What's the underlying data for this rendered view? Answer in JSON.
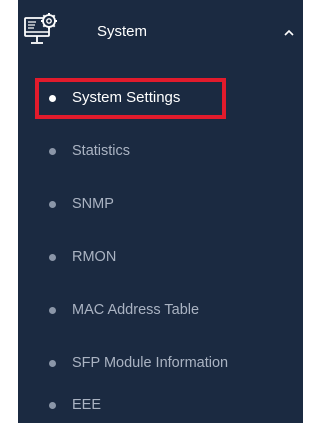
{
  "sidebar": {
    "section": {
      "title": "System",
      "icon": "system-settings-icon",
      "expanded": true,
      "chevron": "chevron-up-icon"
    },
    "items": [
      {
        "label": "System Settings",
        "active": true
      },
      {
        "label": "Statistics",
        "active": false
      },
      {
        "label": "SNMP",
        "active": false
      },
      {
        "label": "RMON",
        "active": false
      },
      {
        "label": "MAC Address Table",
        "active": false
      },
      {
        "label": "SFP Module Information",
        "active": false
      },
      {
        "label": "EEE",
        "active": false
      }
    ]
  },
  "colors": {
    "sidebar_bg": "#1b2a41",
    "active_text": "#ffffff",
    "inactive_text": "#aab3c2",
    "highlight_border": "#e21b2c"
  }
}
